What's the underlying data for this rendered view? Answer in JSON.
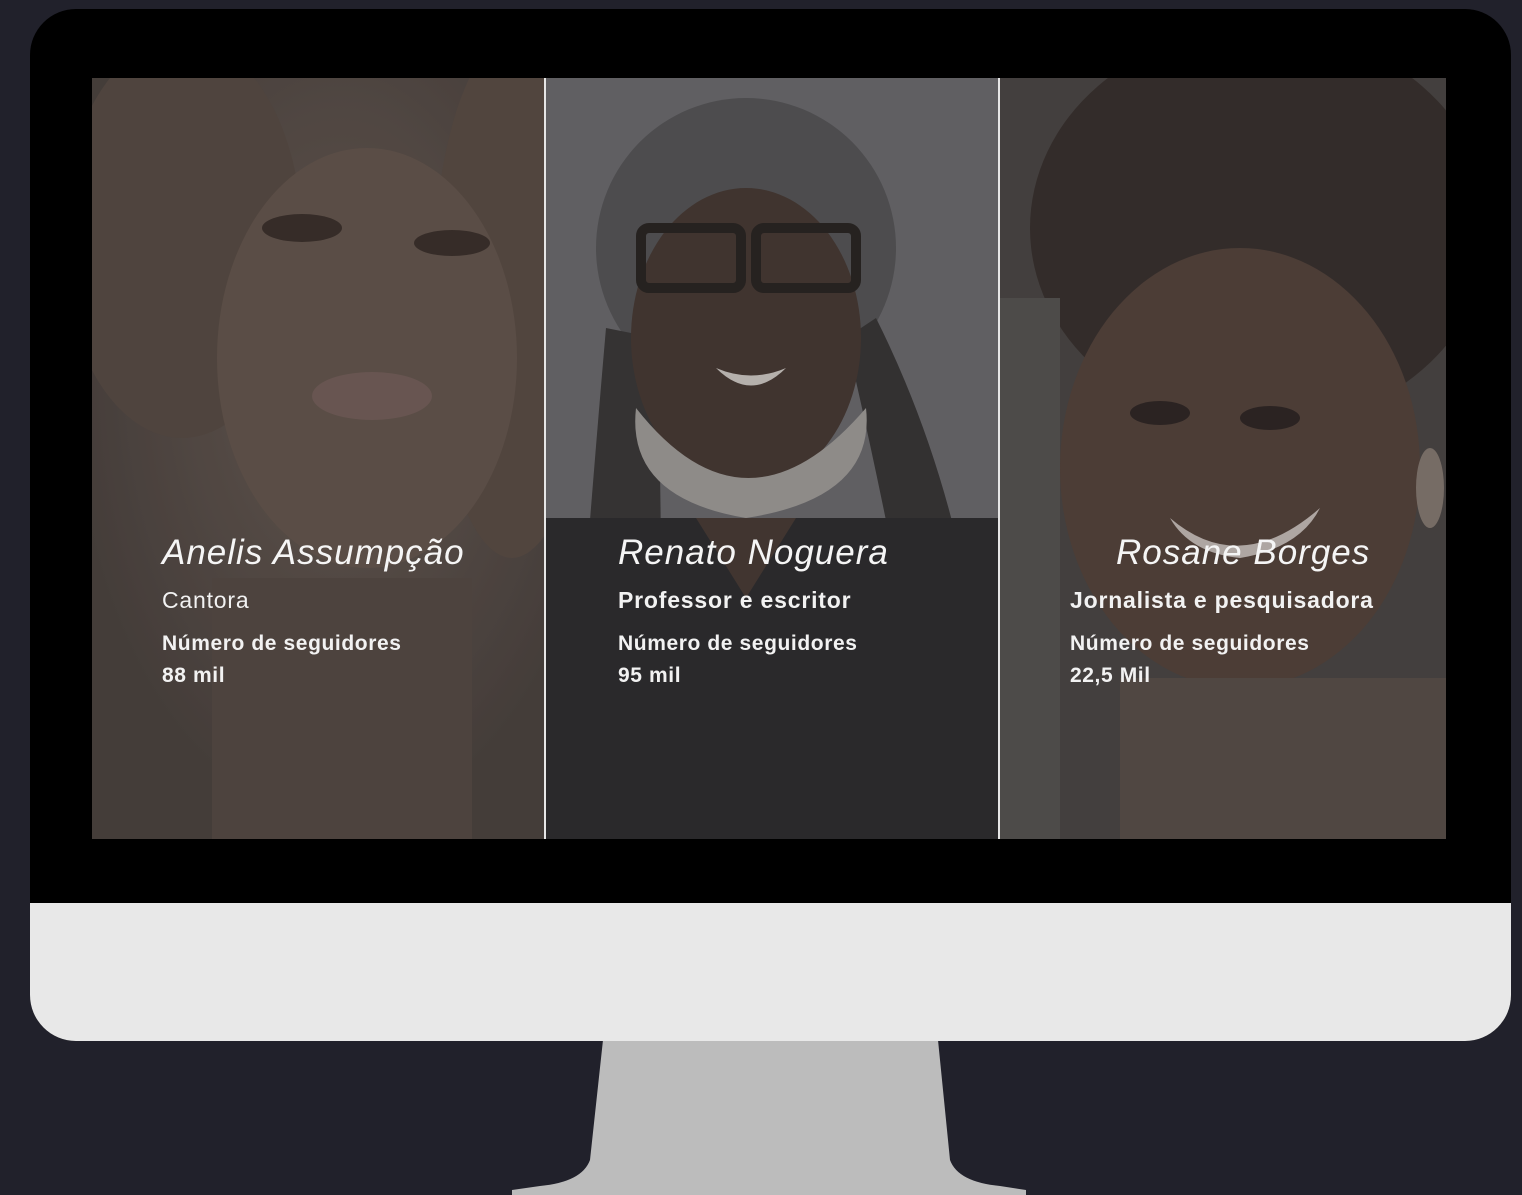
{
  "colors": {
    "background": "#21212b",
    "monitor_bezel": "#000000",
    "monitor_chin": "#e8e8e8",
    "stand": "#bcbcbc",
    "divider": "#e6e6e6",
    "text": "#f2f2f2"
  },
  "profiles": [
    {
      "name": "Anelis Assumpção",
      "role": "Cantora",
      "followers_label": "Número de seguidores",
      "followers_value": "88 mil"
    },
    {
      "name": "Renato Noguera",
      "role": "Professor e escritor",
      "followers_label": "Número de seguidores",
      "followers_value": "95 mil"
    },
    {
      "name": "Rosane Borges",
      "role": "Jornalista e pesquisadora",
      "followers_label": "Número de seguidores",
      "followers_value": "22,5 Mil"
    }
  ]
}
